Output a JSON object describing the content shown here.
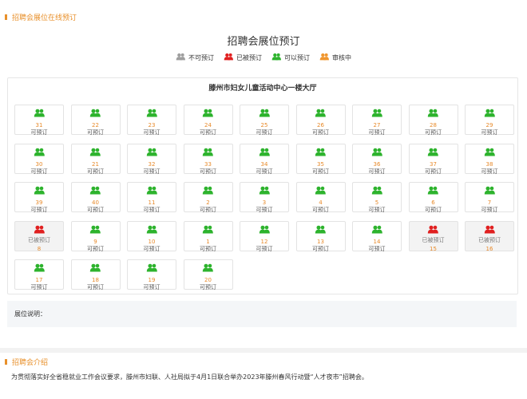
{
  "header": {
    "title": "招聘会展位在线预订"
  },
  "main": {
    "title": "招聘会展位预订",
    "legend": [
      {
        "label": "不可预订",
        "color": "#9e9e9e",
        "icon": "person-pair-icon"
      },
      {
        "label": "已被预订",
        "color": "#e02020",
        "icon": "person-pair-icon"
      },
      {
        "label": "可以预订",
        "color": "#2db32d",
        "icon": "person-pair-icon"
      },
      {
        "label": "审核中",
        "color": "#f0962e",
        "icon": "person-pair-icon"
      }
    ],
    "hall": {
      "name": "滕州市妇女儿童活动中心一楼大厅",
      "rows": [
        [
          {
            "n": "31",
            "s": "可预订"
          },
          {
            "n": "22",
            "s": "可预订"
          },
          {
            "n": "23",
            "s": "可预订"
          },
          {
            "n": "24",
            "s": "可预订"
          },
          {
            "n": "25",
            "s": "可预订"
          },
          {
            "n": "26",
            "s": "可预订"
          },
          {
            "n": "27",
            "s": "可预订"
          },
          {
            "n": "28",
            "s": "可预订"
          },
          {
            "n": "29",
            "s": "可预订"
          }
        ],
        [
          {
            "n": "30",
            "s": "可预订"
          },
          {
            "n": "21",
            "s": "可预订"
          },
          {
            "n": "32",
            "s": "可预订"
          },
          {
            "n": "33",
            "s": "可预订"
          },
          {
            "n": "34",
            "s": "可预订"
          },
          {
            "n": "35",
            "s": "可预订"
          },
          {
            "n": "36",
            "s": "可预订"
          },
          {
            "n": "37",
            "s": "可预订"
          },
          {
            "n": "38",
            "s": "可预订"
          }
        ],
        [
          {
            "n": "39",
            "s": "可预订"
          },
          {
            "n": "40",
            "s": "可预订"
          },
          {
            "n": "11",
            "s": "可预订"
          },
          {
            "n": "2",
            "s": "可预订"
          },
          {
            "n": "3",
            "s": "可预订"
          },
          {
            "n": "4",
            "s": "可预订"
          },
          {
            "n": "5",
            "s": "可预订"
          },
          {
            "n": "6",
            "s": "可预订"
          },
          {
            "n": "7",
            "s": "可预订"
          }
        ],
        [
          {
            "n": "8",
            "s": "已被预订",
            "booked": true
          },
          {
            "n": "9",
            "s": "可预订"
          },
          {
            "n": "10",
            "s": "可预订"
          },
          {
            "n": "1",
            "s": "可预订"
          },
          {
            "n": "12",
            "s": "可预订"
          },
          {
            "n": "13",
            "s": "可预订"
          },
          {
            "n": "14",
            "s": "可预订"
          },
          {
            "n": "15",
            "s": "已被预订",
            "booked": true
          },
          {
            "n": "16",
            "s": "已被预订",
            "booked": true
          }
        ],
        [
          {
            "n": "17",
            "s": "可预订"
          },
          {
            "n": "18",
            "s": "可预订"
          },
          {
            "n": "19",
            "s": "可预订"
          },
          {
            "n": "20",
            "s": "可预订"
          }
        ]
      ]
    },
    "note_label": "展位说明："
  },
  "intro": {
    "title": "招聘会介绍",
    "text": "为贯彻落实好全省稳就业工作会议要求，滕州市妇联、人社局拟于4月1日联合举办2023年滕州春风行动暨“人才夜市”招聘会。"
  },
  "colors": {
    "accent": "#e8902b",
    "available": "#2db32d",
    "booked": "#e02020",
    "number": "#e88a2a"
  }
}
